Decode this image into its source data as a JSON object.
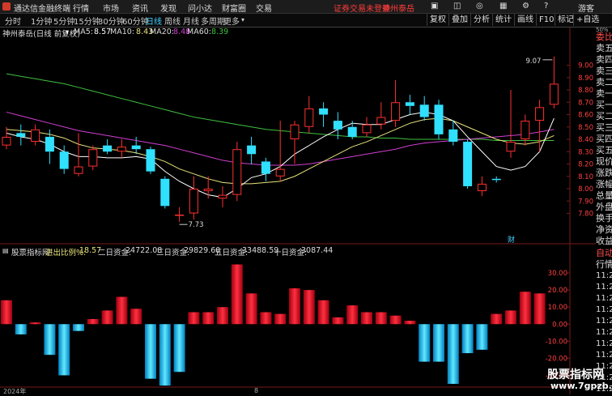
{
  "titlebar": {
    "app_name": "通达信金融终端",
    "menus": [
      "行情",
      "市场",
      "资讯",
      "发现",
      "问小达",
      "财富圈",
      "交易"
    ],
    "warning": "证券交易未登录",
    "user": "神州泰岳",
    "guest": "游客"
  },
  "toolbar": {
    "periods": [
      "分时",
      "1分钟",
      "5分钟",
      "15分钟",
      "30分钟",
      "60分钟",
      "日线",
      "周线",
      "月线",
      "多周期",
      "更多"
    ],
    "active_period": "日线",
    "buttons": [
      "复权",
      "叠加",
      "分析",
      "统计",
      "画线",
      "F10",
      "标记",
      "+自选"
    ]
  },
  "chart_info": {
    "stock": "神州泰岳(日线 前复权)",
    "ma5_label": "MA5:",
    "ma5": "8.57",
    "ma10_label": "MA10:",
    "ma10": "8.43",
    "ma20_label": "MA20:",
    "ma20": "8.48",
    "ma60_label": "MA60:",
    "ma60": "8.39",
    "high_label": "9.07",
    "low_label": "7.73",
    "event_marker": "财",
    "colors": {
      "ma5": "#ffffff",
      "ma10": "#e8e27a",
      "ma20": "#d040d0",
      "ma60": "#40c040",
      "up": "#ff3030",
      "down": "#30e0ff"
    }
  },
  "lower_info": {
    "indicator": "股票指标网",
    "ratio_label": "进出比例%:",
    "ratio": "18.57",
    "day2_label": "二日资金:",
    "day2": "24722.08",
    "day3_label": "三日资金:",
    "day3": "29829.60",
    "day5_label": "五日资金:",
    "day5": "33488.59",
    "day10_label": "十日资金:",
    "day10": "3087.44"
  },
  "sidebar": {
    "items": [
      "委比",
      "卖五",
      "卖四",
      "卖三",
      "卖二",
      "卖一",
      "买一",
      "买二",
      "买三",
      "买四",
      "买五",
      "现价",
      "涨跌",
      "涨幅",
      "总量",
      "外盘",
      "换手",
      "净资",
      "收益"
    ],
    "lower_items": [
      "自动",
      "行情",
      "11:2",
      "11:2",
      "11:2",
      "11:2",
      "11:2",
      "11:2",
      "11:2",
      "11:2",
      "11:2",
      "11:2",
      "11:2"
    ],
    "top_label": "50%"
  },
  "bottom": {
    "year": "2024年",
    "month": "8"
  },
  "watermark": {
    "line1": "股票指标网",
    "line2": "www.7gpzb.com"
  },
  "chart_data": [
    {
      "type": "candlestick",
      "title": "神州泰岳(日线 前复权)",
      "ylim": [
        7.6,
        9.2
      ],
      "yticks": [
        "9.00",
        "8.90",
        "8.80",
        "8.70",
        "8.60",
        "8.50",
        "8.40",
        "8.30",
        "8.20",
        "8.10",
        "8.00",
        "7.90",
        "7.80"
      ],
      "ytick_values": [
        9.0,
        8.9,
        8.8,
        8.7,
        8.6,
        8.5,
        8.4,
        8.3,
        8.2,
        8.1,
        8.0,
        7.9,
        7.8
      ],
      "candles": [
        {
          "o": 8.35,
          "c": 8.42,
          "h": 8.5,
          "l": 8.32
        },
        {
          "o": 8.45,
          "c": 8.42,
          "h": 8.52,
          "l": 8.35
        },
        {
          "o": 8.38,
          "c": 8.48,
          "h": 8.52,
          "l": 8.35
        },
        {
          "o": 8.42,
          "c": 8.3,
          "h": 8.48,
          "l": 8.2
        },
        {
          "o": 8.3,
          "c": 8.16,
          "h": 8.35,
          "l": 8.12
        },
        {
          "o": 8.12,
          "c": 8.18,
          "h": 8.45,
          "l": 8.1
        },
        {
          "o": 8.18,
          "c": 8.32,
          "h": 8.35,
          "l": 8.15
        },
        {
          "o": 8.35,
          "c": 8.3,
          "h": 8.4,
          "l": 8.28
        },
        {
          "o": 8.3,
          "c": 8.34,
          "h": 8.4,
          "l": 8.25
        },
        {
          "o": 8.35,
          "c": 8.32,
          "h": 8.42,
          "l": 8.28
        },
        {
          "o": 8.32,
          "c": 8.14,
          "h": 8.34,
          "l": 8.12
        },
        {
          "o": 8.08,
          "c": 7.86,
          "h": 8.1,
          "l": 7.84
        },
        {
          "o": 7.78,
          "c": 7.79,
          "h": 7.85,
          "l": 7.73
        },
        {
          "o": 7.8,
          "c": 8.0,
          "h": 8.1,
          "l": 7.75
        },
        {
          "o": 7.98,
          "c": 8.0,
          "h": 8.1,
          "l": 7.92
        },
        {
          "o": 7.92,
          "c": 7.95,
          "h": 8.02,
          "l": 7.85
        },
        {
          "o": 7.95,
          "c": 8.32,
          "h": 8.38,
          "l": 7.9
        },
        {
          "o": 8.35,
          "c": 8.28,
          "h": 8.42,
          "l": 8.2
        },
        {
          "o": 8.22,
          "c": 8.12,
          "h": 8.25,
          "l": 8.06
        },
        {
          "o": 8.1,
          "c": 8.16,
          "h": 8.55,
          "l": 8.06
        },
        {
          "o": 8.4,
          "c": 8.52,
          "h": 8.55,
          "l": 8.2
        },
        {
          "o": 8.5,
          "c": 8.65,
          "h": 8.75,
          "l": 8.45
        },
        {
          "o": 8.65,
          "c": 8.6,
          "h": 8.7,
          "l": 8.5
        },
        {
          "o": 8.55,
          "c": 8.48,
          "h": 8.62,
          "l": 8.4
        },
        {
          "o": 8.5,
          "c": 8.42,
          "h": 8.55,
          "l": 8.4
        },
        {
          "o": 8.45,
          "c": 8.52,
          "h": 8.58,
          "l": 8.42
        },
        {
          "o": 8.52,
          "c": 8.58,
          "h": 8.7,
          "l": 8.48
        },
        {
          "o": 8.55,
          "c": 8.7,
          "h": 8.88,
          "l": 8.5
        },
        {
          "o": 8.7,
          "c": 8.67,
          "h": 8.76,
          "l": 8.6
        },
        {
          "o": 8.68,
          "c": 8.58,
          "h": 8.75,
          "l": 8.55
        },
        {
          "o": 8.68,
          "c": 8.44,
          "h": 8.72,
          "l": 8.4
        },
        {
          "o": 8.48,
          "c": 8.38,
          "h": 8.55,
          "l": 8.35
        },
        {
          "o": 8.38,
          "c": 8.02,
          "h": 8.4,
          "l": 8.0
        },
        {
          "o": 7.98,
          "c": 8.04,
          "h": 8.1,
          "l": 7.94
        },
        {
          "o": 8.08,
          "c": 8.07,
          "h": 8.1,
          "l": 8.05
        },
        {
          "o": 8.3,
          "c": 8.38,
          "h": 8.8,
          "l": 8.25
        },
        {
          "o": 8.4,
          "c": 8.55,
          "h": 8.6,
          "l": 8.35
        },
        {
          "o": 8.55,
          "c": 8.66,
          "h": 8.72,
          "l": 8.3
        },
        {
          "o": 8.68,
          "c": 8.85,
          "h": 9.07,
          "l": 8.65
        }
      ],
      "ma5": [
        8.45,
        8.42,
        8.4,
        8.36,
        8.3,
        8.26,
        8.26,
        8.25,
        8.25,
        8.26,
        8.24,
        8.14,
        8.06,
        8.0,
        7.95,
        7.93,
        8.0,
        8.09,
        8.12,
        8.18,
        8.28,
        8.35,
        8.42,
        8.48,
        8.53,
        8.52,
        8.52,
        8.56,
        8.6,
        8.62,
        8.6,
        8.55,
        8.42,
        8.3,
        8.18,
        8.15,
        8.18,
        8.3,
        8.57
      ],
      "ma10": [
        8.48,
        8.47,
        8.46,
        8.44,
        8.41,
        8.36,
        8.33,
        8.32,
        8.31,
        8.29,
        8.26,
        8.22,
        8.16,
        8.12,
        8.08,
        8.05,
        8.04,
        8.04,
        8.05,
        8.06,
        8.1,
        8.16,
        8.22,
        8.28,
        8.34,
        8.38,
        8.43,
        8.48,
        8.53,
        8.56,
        8.57,
        8.55,
        8.5,
        8.45,
        8.4,
        8.37,
        8.36,
        8.38,
        8.43
      ],
      "ma20": [
        8.62,
        8.59,
        8.56,
        8.53,
        8.5,
        8.47,
        8.45,
        8.43,
        8.41,
        8.39,
        8.37,
        8.35,
        8.32,
        8.29,
        8.26,
        8.23,
        8.21,
        8.2,
        8.19,
        8.19,
        8.19,
        8.2,
        8.22,
        8.24,
        8.26,
        8.28,
        8.3,
        8.32,
        8.35,
        8.37,
        8.38,
        8.39,
        8.4,
        8.41,
        8.42,
        8.43,
        8.44,
        8.46,
        8.48
      ],
      "ma60": [
        8.93,
        8.91,
        8.89,
        8.87,
        8.85,
        8.82,
        8.79,
        8.76,
        8.73,
        8.7,
        8.67,
        8.64,
        8.61,
        8.58,
        8.56,
        8.54,
        8.52,
        8.5,
        8.48,
        8.47,
        8.46,
        8.45,
        8.44,
        8.43,
        8.42,
        8.42,
        8.41,
        8.41,
        8.4,
        8.4,
        8.4,
        8.4,
        8.4,
        8.4,
        8.39,
        8.39,
        8.39,
        8.39,
        8.39
      ]
    },
    {
      "type": "bar",
      "title": "股票指标网",
      "ylim": [
        -35,
        40
      ],
      "yticks": [
        "30.00",
        "20.00",
        "10.00",
        "0.00",
        "-10.00",
        "-20.00",
        "-30.00"
      ],
      "ytick_values": [
        30,
        20,
        10,
        0,
        -10,
        -20,
        -30
      ],
      "values": [
        14,
        -6,
        1,
        -18,
        -30,
        -4,
        3,
        8,
        16,
        9,
        -32,
        -36,
        -28,
        7,
        7,
        10,
        35,
        18,
        7,
        6,
        21,
        20,
        14,
        4,
        11,
        7,
        7,
        5,
        2,
        -22,
        -22,
        -35,
        -17,
        -15,
        6,
        8,
        19,
        18
      ]
    }
  ]
}
